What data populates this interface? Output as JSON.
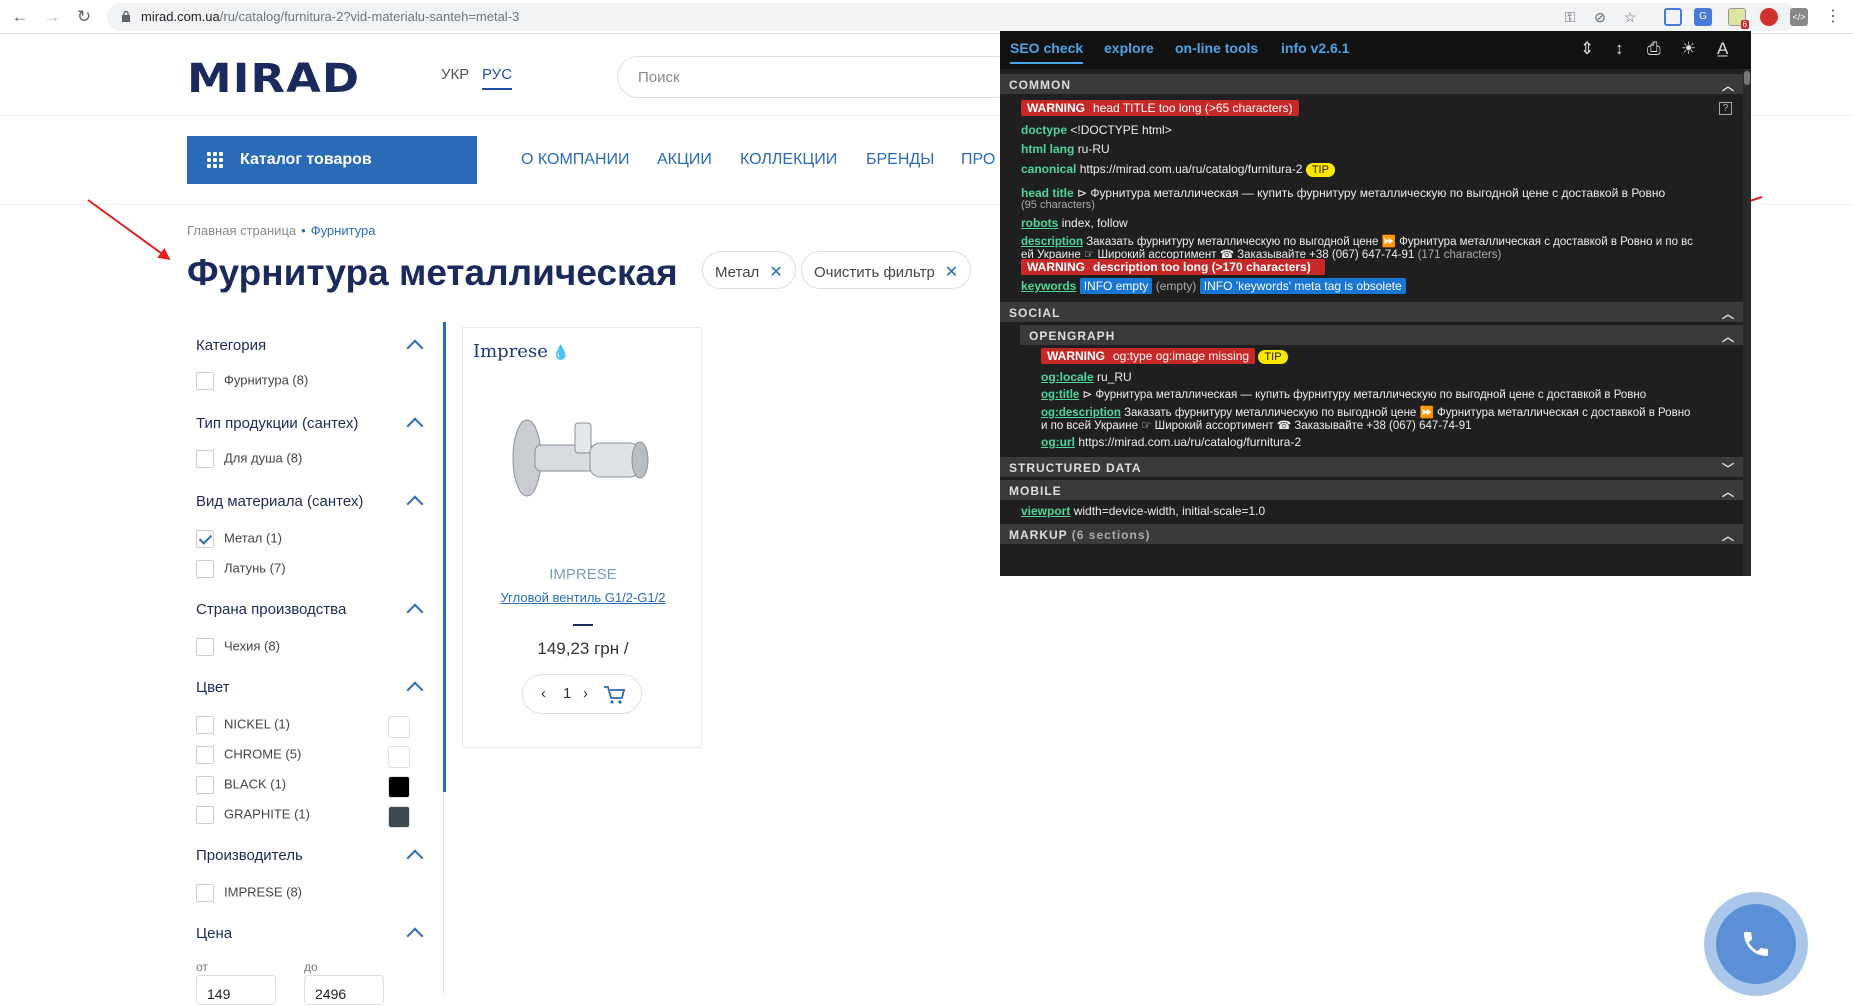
{
  "browser": {
    "url_host": "mirad.com.ua",
    "url_path": "/ru/catalog/furnitura-2?vid-materialu-santeh=metal-3",
    "ext_badge": "6"
  },
  "header": {
    "logo": "MIRAD",
    "lang_ukr": "УКР",
    "lang_rus": "РУС",
    "search_placeholder": "Поиск"
  },
  "catalog_button": "Каталог товаров",
  "menu": [
    "О КОМПАНИИ",
    "АКЦИИ",
    "КОЛЛЕКЦИИ",
    "БРЕНДЫ",
    "ПРО"
  ],
  "breadcrumb": {
    "home": "Главная страница",
    "current": "Фурнитура"
  },
  "page_title": "Фурнитура металлическая",
  "chips": {
    "metal": "Метал",
    "clear": "Очистить фильтр"
  },
  "filters": {
    "category": {
      "title": "Категория",
      "items": [
        "Фурнитура (8)"
      ]
    },
    "product_type": {
      "title": "Тип продукции (сантех)",
      "items": [
        "Для душа (8)"
      ]
    },
    "material": {
      "title": "Вид материала (сантех)",
      "items": [
        "Метал (1)",
        "Латунь (7)"
      ]
    },
    "country": {
      "title": "Страна производства",
      "items": [
        "Чехия (8)"
      ]
    },
    "color": {
      "title": "Цвет",
      "items": [
        "NICKEL (1)",
        "CHROME (5)",
        "BLACK (1)",
        "GRAPHITE (1)"
      ],
      "swatches": [
        "#ffffff",
        "#ffffff",
        "#000000",
        "#3d4a4f"
      ]
    },
    "maker": {
      "title": "Производитель",
      "items": [
        "IMPRESE (8)"
      ]
    },
    "price": {
      "title": "Цена",
      "from_label": "от",
      "to_label": "до",
      "from_value": "149",
      "to_value": "2496"
    }
  },
  "product": {
    "logo": "Imprese",
    "brand": "IMPRESE",
    "name": "Угловой вентиль G1/2-G1/2",
    "price": "149,23 грн /",
    "qty": "1"
  },
  "seo": {
    "tabs": [
      "SEO check",
      "explore",
      "on-line tools",
      "info v2.6.1"
    ],
    "sections": {
      "common": "COMMON",
      "social": "SOCIAL",
      "opengraph": "OPENGRAPH",
      "structured": "STRUCTURED DATA",
      "mobile": "MOBILE",
      "markup": "MARKUP",
      "markup_sections": "(6 sections)"
    },
    "warn_label": "WARNING",
    "info_label": "INFO",
    "tip_label": "TIP",
    "warn_title": "head TITLE too long (>65 characters)",
    "doctype_k": "doctype",
    "doctype_v": "<!DOCTYPE html>",
    "lang_k": "html lang",
    "lang_v": "ru-RU",
    "canonical_k": "canonical",
    "canonical_v": "https://mirad.com.ua/ru/catalog/furnitura-2",
    "title_k": "head title",
    "title_v": "⊳ Фурнитура металлическая — купить фурнитуру металлическую по выгодной цене с доставкой в Ровно",
    "title_count": "(95 characters)",
    "robots_k": "robots",
    "robots_v": "index, follow",
    "desc_k": "description",
    "desc_v1": "Заказать фурнитуру металлическую по выгодной цене ⏩ Фурнитура металлическая с доставкой в Ровно и по вс",
    "desc_v2": "ей Украине ☞ Широкий ассортимент ☎ Заказывайте +38 (067) 647-74-91",
    "desc_count": "(171 characters)",
    "warn_desc": "description too long (>170 characters)",
    "keywords_k": "keywords",
    "kw_empty": "empty",
    "kw_empty2": "(empty)",
    "kw_obsolete": "'keywords' meta tag is obsolete",
    "og_warn": "og:type og:image missing",
    "og_locale_k": "og:locale",
    "og_locale_v": "ru_RU",
    "og_title_k": "og:title",
    "og_title_v": "⊳ Фурнитура металлическая — купить фурнитуру металлическую по выгодной цене с доставкой в Ровно",
    "og_desc_k": "og:description",
    "og_desc_v1": "Заказать фурнитуру металлическую по выгодной цене ⏩ Фурнитура металлическая с доставкой в Ровно",
    "og_desc_v2": "и по всей Украине ☞ Широкий ассортимент ☎ Заказывайте +38 (067) 647-74-91",
    "og_url_k": "og:url",
    "og_url_v": "https://mirad.com.ua/ru/catalog/furnitura-2",
    "viewport_k": "viewport",
    "viewport_v": "width=device-width, initial-scale=1.0"
  },
  "colors": {
    "brand_blue": "#2a6bb8",
    "navy": "#1b2a5c",
    "warning": "#c62828",
    "info": "#1976d2",
    "tip": "#ffe600",
    "seo_key": "#4fd59a"
  }
}
